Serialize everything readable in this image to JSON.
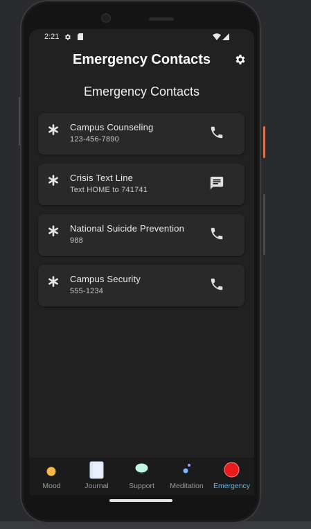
{
  "status_bar": {
    "time": "2:21"
  },
  "app_bar": {
    "title": "Emergency Contacts",
    "settings_icon": "gear-icon"
  },
  "section_title": "Emergency Contacts",
  "contacts": [
    {
      "name": "Campus Counseling",
      "detail": "123-456-7890",
      "action_icon": "phone-icon"
    },
    {
      "name": "Crisis Text Line",
      "detail": "Text HOME to 741741",
      "action_icon": "message-icon"
    },
    {
      "name": "National Suicide Prevention",
      "detail": "988",
      "action_icon": "phone-icon"
    },
    {
      "name": "Campus Security",
      "detail": "555-1234",
      "action_icon": "phone-icon"
    }
  ],
  "bottom_nav": {
    "items": [
      {
        "label": "Mood",
        "icon": "mood-icon",
        "color": "#f5b74a"
      },
      {
        "label": "Journal",
        "icon": "journal-icon",
        "color": "#e8f0ff"
      },
      {
        "label": "Support",
        "icon": "support-icon",
        "color": "#bff7e0"
      },
      {
        "label": "Meditation",
        "icon": "meditation-icon",
        "color": "#7ab8ff"
      },
      {
        "label": "Emergency",
        "icon": "emergency-icon",
        "color": "#e81c1c",
        "active": true
      }
    ]
  },
  "colors": {
    "background": "#212121",
    "card": "#292929",
    "active_tab": "#5bb8f0",
    "icon": "#e0e0e0"
  }
}
